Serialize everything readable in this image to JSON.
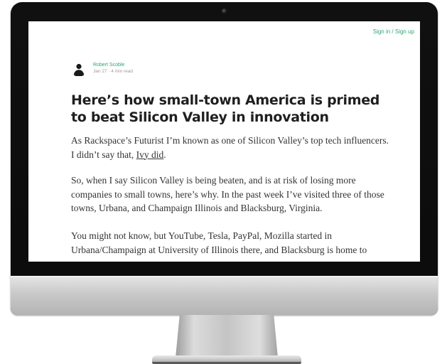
{
  "header": {
    "signin_label": "Sign in / Sign up"
  },
  "author": {
    "name": "Robert Scoble",
    "meta": "Jan 27 · 4 min read"
  },
  "article": {
    "title": "Here’s how small-town America is primed to beat Silicon Valley in innovation",
    "p1_text": "As Rackspace’s Futurist I’m known as one of Silicon Valley’s top tech influencers. I didn’t say that, ",
    "p1_link": "Ivy did",
    "p1_end": ".",
    "p2": "So, when I say Silicon Valley is being beaten, and is at risk of losing more companies to small towns, here’s why. In the past week I’ve visited three of those towns, Urbana, and Champaign Illinois and Blacksburg, Virginia.",
    "p3": "You might not know, but YouTube, Tesla, PayPal, Mozilla started in Urbana/Champaign at University of Illinois there, and Blacksburg is home to"
  },
  "colors": {
    "accent": "#2ea56f",
    "bezel": "#0d0d0d",
    "text": "#333333"
  }
}
